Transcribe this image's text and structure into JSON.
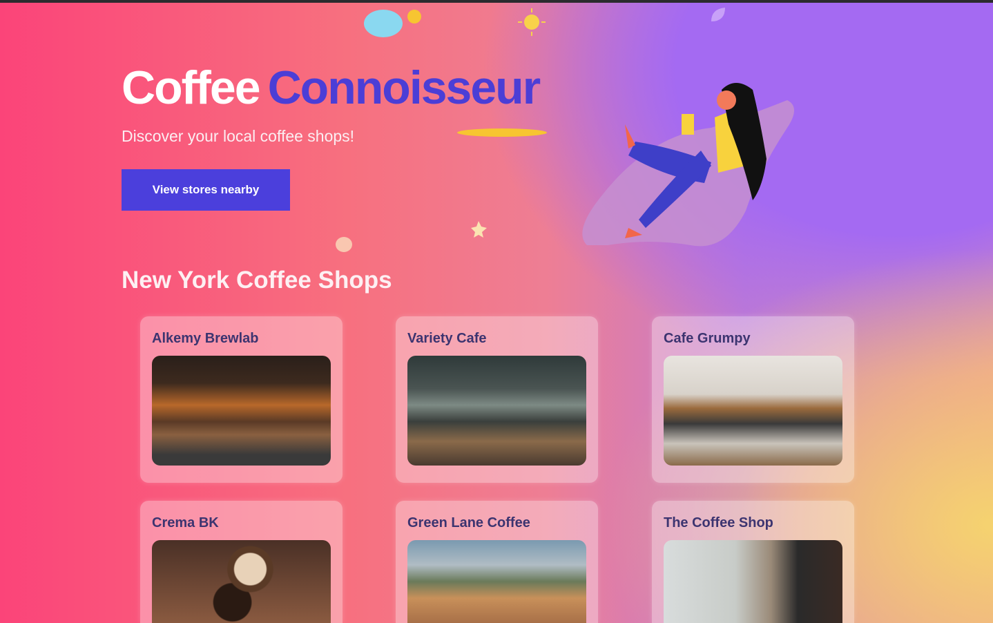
{
  "hero": {
    "title_part1": "Coffee",
    "title_part2": "Connoisseur",
    "subtitle": "Discover your local coffee shops!",
    "cta_label": "View stores nearby"
  },
  "section": {
    "title": "New York Coffee Shops"
  },
  "stores": [
    {
      "name": "Alkemy Brewlab"
    },
    {
      "name": "Variety Cafe"
    },
    {
      "name": "Cafe Grumpy"
    },
    {
      "name": "Crema BK"
    },
    {
      "name": "Green Lane Coffee"
    },
    {
      "name": "The Coffee Shop"
    }
  ],
  "colors": {
    "accent": "#4b3fdc",
    "title_blue": "#4b3ed6",
    "card_text": "#3c3470"
  }
}
